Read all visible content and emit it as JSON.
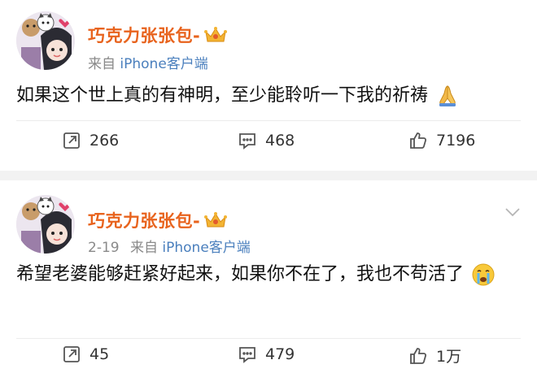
{
  "posts": [
    {
      "author": "巧克力张张包-",
      "date": "",
      "source_prefix": "来自",
      "source_app": "iPhone客户端",
      "text": "如果这个世上真的有神明，至少能聆听一下我的祈祷",
      "emoji": "praying-hands-emoji",
      "reposts": "266",
      "comments": "468",
      "likes": "7196"
    },
    {
      "author": "巧克力张张包-",
      "date": "2-19",
      "source_prefix": "来自",
      "source_app": "iPhone客户端",
      "text": "希望老婆能够赶紧好起来，如果你不在了，我也不苟活了",
      "emoji": "crying-face-emoji",
      "reposts": "45",
      "comments": "479",
      "likes": "1万"
    }
  ],
  "colors": {
    "author": "#e8631d",
    "source_link": "#4a7fbd",
    "meta": "#8a8a8a",
    "separator": "#f2f2f2"
  },
  "icons": [
    "repost-icon",
    "comment-icon",
    "like-icon",
    "chevron-down-icon",
    "vip-crown-icon"
  ]
}
